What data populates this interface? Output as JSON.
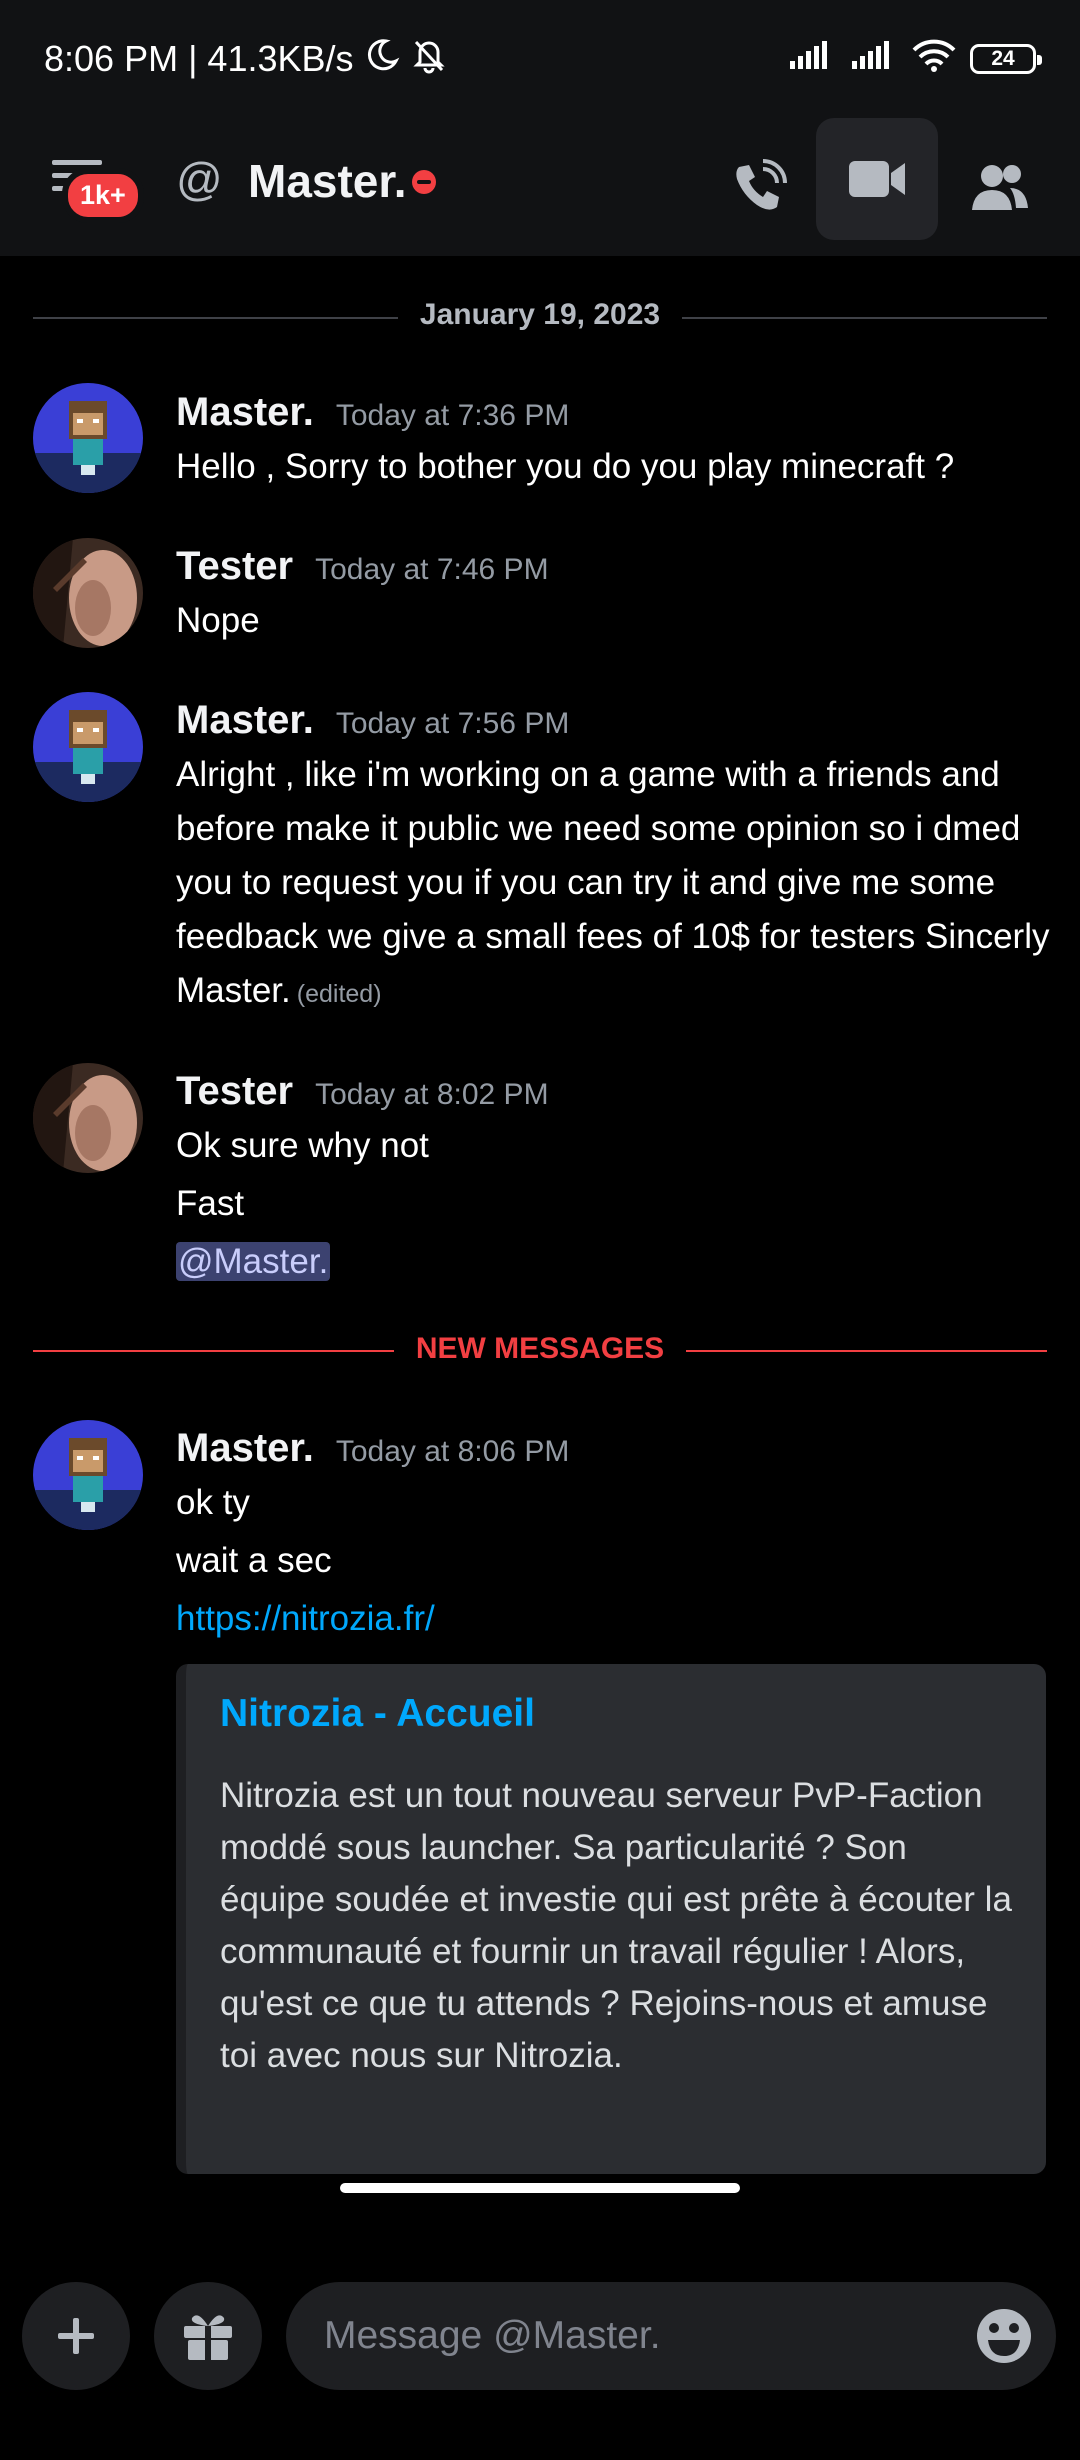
{
  "status_bar": {
    "time_speed": "8:06 PM | 41.3KB/s",
    "battery": "24"
  },
  "header": {
    "badge": "1k+",
    "title": "Master."
  },
  "date_divider": "January 19, 2023",
  "new_messages_divider": "NEW MESSAGES",
  "messages": [
    {
      "author": "Master.",
      "timestamp": "Today at 7:36 PM",
      "lines": [
        "Hello , Sorry to bother you do you play minecraft ?"
      ]
    },
    {
      "author": "Tester",
      "timestamp": "Today at 7:46 PM",
      "lines": [
        "Nope"
      ]
    },
    {
      "author": "Master.",
      "timestamp": "Today at 7:56 PM",
      "text": "Alright , like i'm working on a game with a friends and before make it public we need some opinion so i dmed you to request you if you can try it and give me some feedback we give a small fees of 10$ for testers Sincerly Master.",
      "edited": "(edited)"
    },
    {
      "author": "Tester",
      "timestamp": "Today at 8:02 PM",
      "lines": [
        "Ok sure why not",
        "Fast"
      ],
      "mention": "@Master."
    },
    {
      "author": "Master.",
      "timestamp": "Today at 8:06 PM",
      "lines": [
        "ok ty",
        "wait a sec"
      ],
      "link": "https://nitrozia.fr/"
    }
  ],
  "embed": {
    "title": "Nitrozia - Accueil",
    "description": "Nitrozia est un tout nouveau serveur PvP-Faction moddé sous launcher. Sa particularité ? Son équipe soudée et investie qui est prête à écouter la communauté et fournir un travail régulier ! Alors, qu'est ce que tu attends ? Rejoins-nous et amuse toi avec nous sur Nitrozia."
  },
  "composer": {
    "placeholder": "Message @Master."
  },
  "icons": [
    "moon-icon",
    "bell-off-icon",
    "signal-icon",
    "wifi-icon",
    "menu-icon",
    "at-icon",
    "phone-icon",
    "video-icon",
    "members-icon",
    "plus-icon",
    "gift-icon",
    "emoji-icon"
  ],
  "colors": {
    "accent_red": "#f23f42",
    "link_blue": "#00a8fc",
    "background": "#000000",
    "header": "#111214"
  }
}
